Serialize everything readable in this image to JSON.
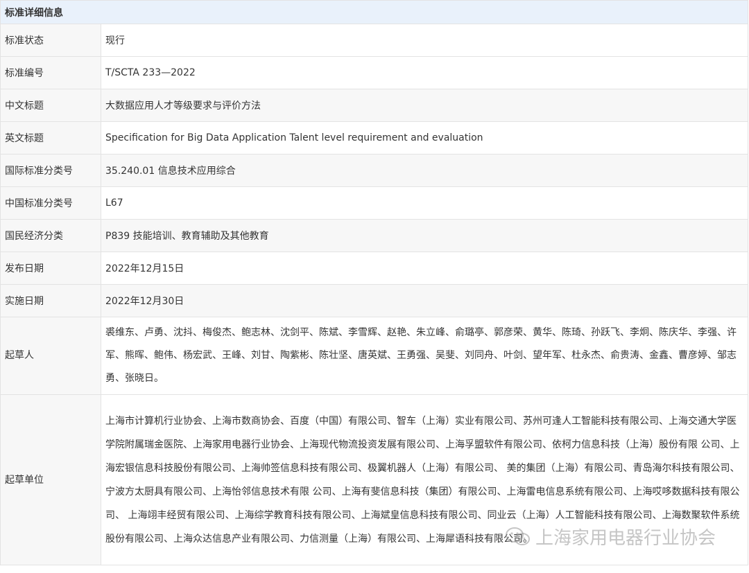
{
  "header": {
    "title": "标准详细信息"
  },
  "rows": [
    {
      "label": "标准状态",
      "value": "现行"
    },
    {
      "label": "标准编号",
      "value": "T/SCTA 233—2022"
    },
    {
      "label": "中文标题",
      "value": "大数据应用人才等级要求与评价方法"
    },
    {
      "label": "英文标题",
      "value": "Specification for Big Data Application Talent level requirement and evaluation"
    },
    {
      "label": "国际标准分类号",
      "value": "35.240.01 信息技术应用综合"
    },
    {
      "label": "中国标准分类号",
      "value": "L67"
    },
    {
      "label": "国民经济分类",
      "value": "P839 技能培训、教育辅助及其他教育"
    },
    {
      "label": "发布日期",
      "value": "2022年12月15日"
    },
    {
      "label": "实施日期",
      "value": "2022年12月30日"
    },
    {
      "label": "起草人",
      "value": "裘维东、卢勇、沈抖、梅俊杰、鲍志林、沈剑平、陈斌、李雪辉、赵艳、朱立峰、俞璐亭、郭彦荣、黄华、陈琦、孙跃飞、李炯、陈庆华、李强、许军、熊晖、鲍伟、杨宏武、王峰、刘甘、陶紫彬、陈壮坚、唐英斌、王勇强、吴斐、刘同舟、叶剑、望年军、杜永杰、俞贵涛、金鑫、曹彦婷、邹志勇、张晓日。"
    },
    {
      "label": "起草单位",
      "value": "上海市计算机行业协会、上海市数商协会、百度（中国）有限公司、智车（上海）实业有限公司、苏州可逢人工智能科技有限公司、上海交通大学医学院附属瑞金医院、上海家用电器行业协会、上海现代物流投资发展有限公司、上海孚盟软件有限公司、依柯力信息科技（上海）股份有限 公司、上海宏银信息科技股份有限公司、上海帅签信息科技有限公司、极翼机器人（上海）有限公司、 美的集团（上海）有限公司、青岛海尔科技有限公司、宁波方太厨具有限公司、上海怡邻信息技术有限 公司、上海有斐信息科技（集团）有限公司、上海雷电信息系统有限公司、上海哎哆数据科技有限公司、 上海翊丰经贸有限公司、上海综学教育科技有限公司、上海斌皇信息科技有限公司、同业云（上海）人工智能科技有限公司、上海数聚软件系统股份有限公司、上海众达信息产业有限公司、力信测量（上海）有限公司、上海犀语科技有限公司。"
    }
  ],
  "watermark": {
    "text": "上海家用电器行业协会",
    "icon": "wechat-icon"
  }
}
